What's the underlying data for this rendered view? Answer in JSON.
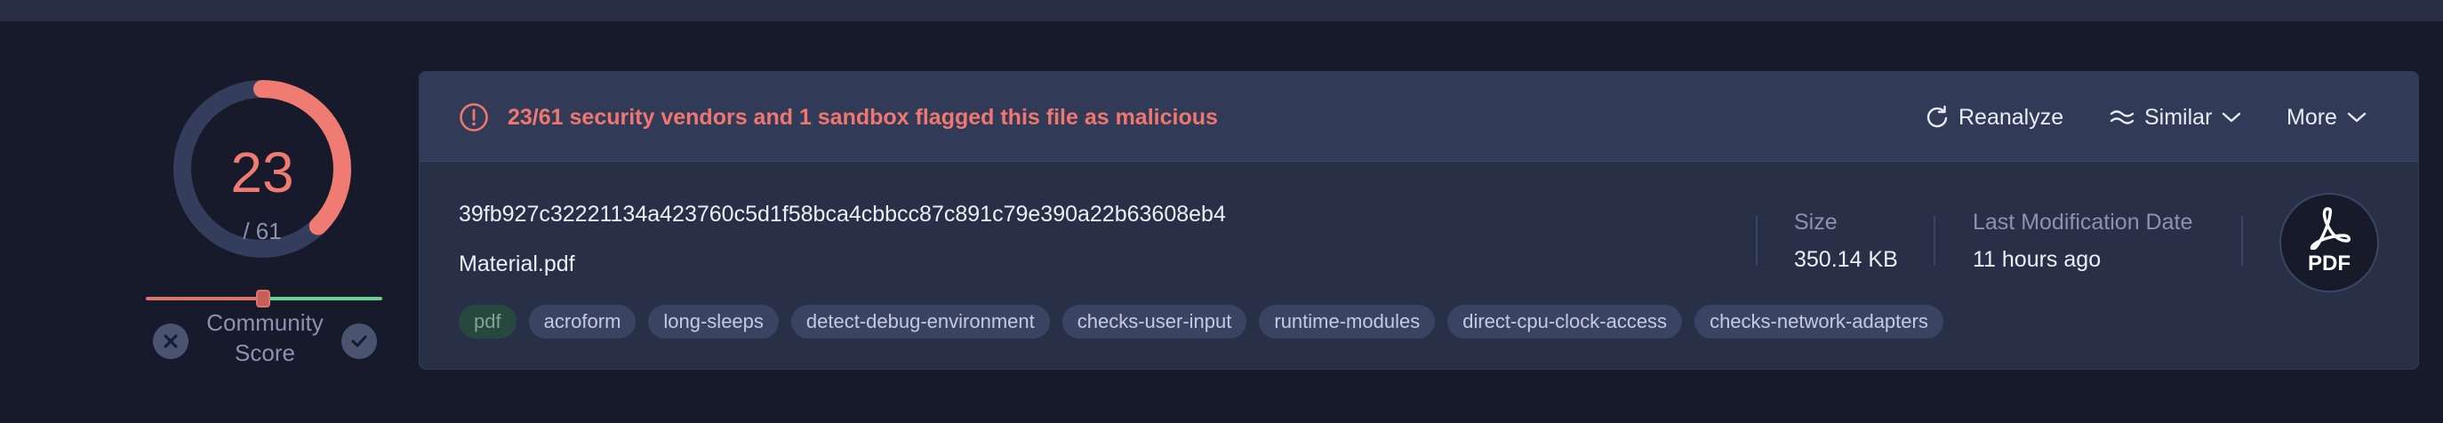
{
  "score": {
    "detections": "23",
    "total": "/ 61",
    "detection_ratio": 0.377,
    "community_label": "Community\nScore",
    "gauge_color": "#f07b72",
    "ring_color": "#343d5b"
  },
  "banner": {
    "alert": "23/61 security vendors and 1 sandbox flagged this file as malicious",
    "reanalyze": "Reanalyze",
    "similar": "Similar",
    "more": "More",
    "alert_color": "#f0776f"
  },
  "file": {
    "hash": "39fb927c32221134a423760c5d1f58bca4cbbcc87c891c79e390a22b63608eb4",
    "name": "Material.pdf",
    "tags": [
      "pdf",
      "acroform",
      "long-sleeps",
      "detect-debug-environment",
      "checks-user-input",
      "runtime-modules",
      "direct-cpu-clock-access",
      "checks-network-adapters"
    ],
    "size_label": "Size",
    "size_value": "350.14 KB",
    "modified_label": "Last Modification Date",
    "modified_value": "11 hours ago",
    "type_badge": "PDF"
  },
  "icons": [
    "alert-circle-icon",
    "refresh-icon",
    "similar-icon",
    "chevron-down-icon",
    "close-icon",
    "check-icon",
    "acrobat-icon"
  ]
}
